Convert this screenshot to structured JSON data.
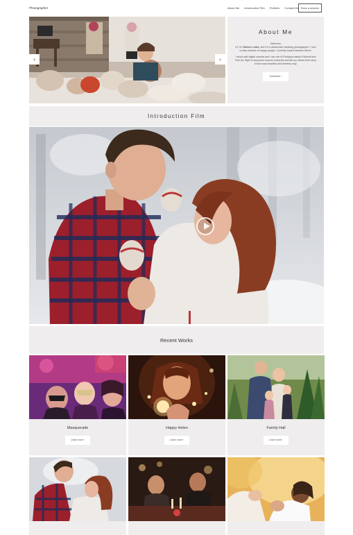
{
  "nav": {
    "brand": "Photographer",
    "links": [
      "About Me",
      "Introduction Film",
      "Portfolio",
      "Contact Me"
    ],
    "cta": "Book a session"
  },
  "hero": {
    "prev_icon": "chevron-left-icon",
    "next_icon": "chevron-right-icon"
  },
  "about": {
    "title": "About Me",
    "welcome": "Welcome",
    "intro_name": "Sheree Lewis",
    "intro_pre": "Hi, I'm ",
    "intro_post": ", and I'm a destructive wedding photographer. I love to take pictures of happy people. Currently based between Mirrot.",
    "para2": "I shoot with digital camera and i use mix of Photojournalistic Editorial and Fine Art Style to document sincere moments and tell my clients their story in the most beautiful and timeless way.",
    "button": "Subscribe ›"
  },
  "intro": {
    "title": "Introduction Film",
    "play_icon": "play-icon"
  },
  "recent": {
    "title": "Recent Works",
    "items": [
      {
        "title": "Masquerade",
        "button": "Learn more ›"
      },
      {
        "title": "Happy Helen",
        "button": "Learn more ›"
      },
      {
        "title": "Family Hall",
        "button": "Learn more ›"
      },
      {
        "title": "",
        "button": ""
      },
      {
        "title": "",
        "button": ""
      },
      {
        "title": "",
        "button": ""
      }
    ]
  },
  "colors": {
    "panel": "#efedee",
    "background": "#ffffff",
    "text": "#333333"
  }
}
